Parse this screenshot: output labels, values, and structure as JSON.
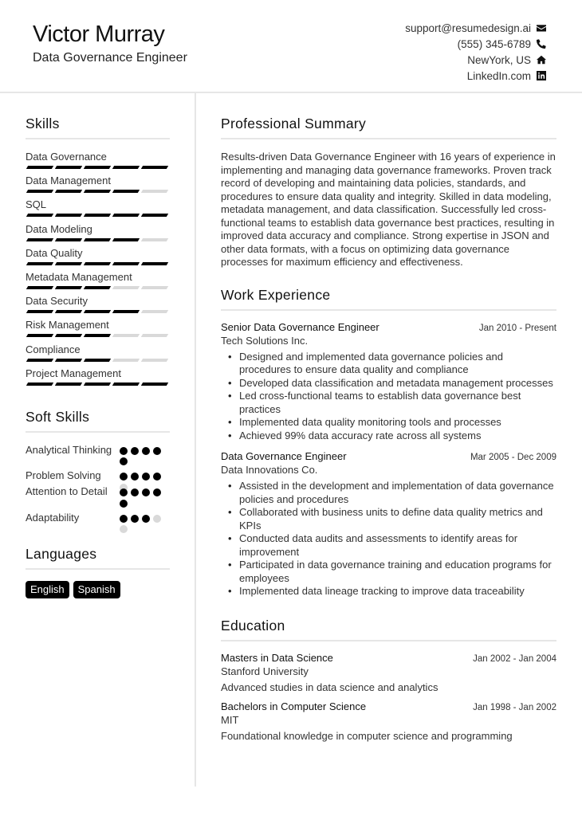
{
  "header": {
    "name": "Victor Murray",
    "title": "Data Governance Engineer",
    "contacts": [
      {
        "text": "support@resumedesign.ai",
        "icon": "envelope-icon"
      },
      {
        "text": "(555) 345-6789",
        "icon": "phone-icon"
      },
      {
        "text": "NewYork, US",
        "icon": "home-icon"
      },
      {
        "text": "LinkedIn.com",
        "icon": "linkedin-icon"
      }
    ]
  },
  "skills": {
    "title": "Skills",
    "max": 5,
    "items": [
      {
        "label": "Data Governance",
        "level": 5
      },
      {
        "label": "Data Management",
        "level": 4
      },
      {
        "label": "SQL",
        "level": 5
      },
      {
        "label": "Data Modeling",
        "level": 4
      },
      {
        "label": "Data Quality",
        "level": 5
      },
      {
        "label": "Metadata Management",
        "level": 3
      },
      {
        "label": "Data Security",
        "level": 4
      },
      {
        "label": "Risk Management",
        "level": 3
      },
      {
        "label": "Compliance",
        "level": 3
      },
      {
        "label": "Project Management",
        "level": 5
      }
    ]
  },
  "soft_skills": {
    "title": "Soft Skills",
    "max": 5,
    "items": [
      {
        "label": "Analytical Thinking",
        "level": 5
      },
      {
        "label": "Problem Solving",
        "level": 4
      },
      {
        "label": "Attention to Detail",
        "level": 5
      },
      {
        "label": "Adaptability",
        "level": 3
      }
    ]
  },
  "languages": {
    "title": "Languages",
    "items": [
      "English",
      "Spanish"
    ]
  },
  "summary": {
    "title": "Professional Summary",
    "text": "Results-driven Data Governance Engineer with 16 years of experience in implementing and managing data governance frameworks. Proven track record of developing and maintaining data policies, standards, and procedures to ensure data quality and integrity. Skilled in data modeling, metadata management, and data classification. Successfully led cross-functional teams to establish data governance best practices, resulting in improved data accuracy and compliance. Strong expertise in JSON and other data formats, with a focus on optimizing data governance processes for maximum efficiency and effectiveness."
  },
  "work": {
    "title": "Work Experience",
    "jobs": [
      {
        "role": "Senior Data Governance Engineer",
        "dates": "Jan 2010 - Present",
        "company": "Tech Solutions Inc.",
        "bullets": [
          "Designed and implemented data governance policies and procedures to ensure data quality and compliance",
          "Developed data classification and metadata management processes",
          "Led cross-functional teams to establish data governance best practices",
          "Implemented data quality monitoring tools and processes",
          "Achieved 99% data accuracy rate across all systems"
        ]
      },
      {
        "role": "Data Governance Engineer",
        "dates": "Mar 2005 - Dec 2009",
        "company": "Data Innovations Co.",
        "bullets": [
          "Assisted in the development and implementation of data governance policies and procedures",
          "Collaborated with business units to define data quality metrics and KPIs",
          "Conducted data audits and assessments to identify areas for improvement",
          "Participated in data governance training and education programs for employees",
          "Implemented data lineage tracking to improve data traceability"
        ]
      }
    ]
  },
  "education": {
    "title": "Education",
    "items": [
      {
        "degree": "Masters in Data Science",
        "dates": "Jan 2002 - Jan 2004",
        "school": "Stanford University",
        "description": "Advanced studies in data science and analytics"
      },
      {
        "degree": "Bachelors in Computer Science",
        "dates": "Jan 1998 - Jan 2002",
        "school": "MIT",
        "description": "Foundational knowledge in computer science and programming"
      }
    ]
  }
}
